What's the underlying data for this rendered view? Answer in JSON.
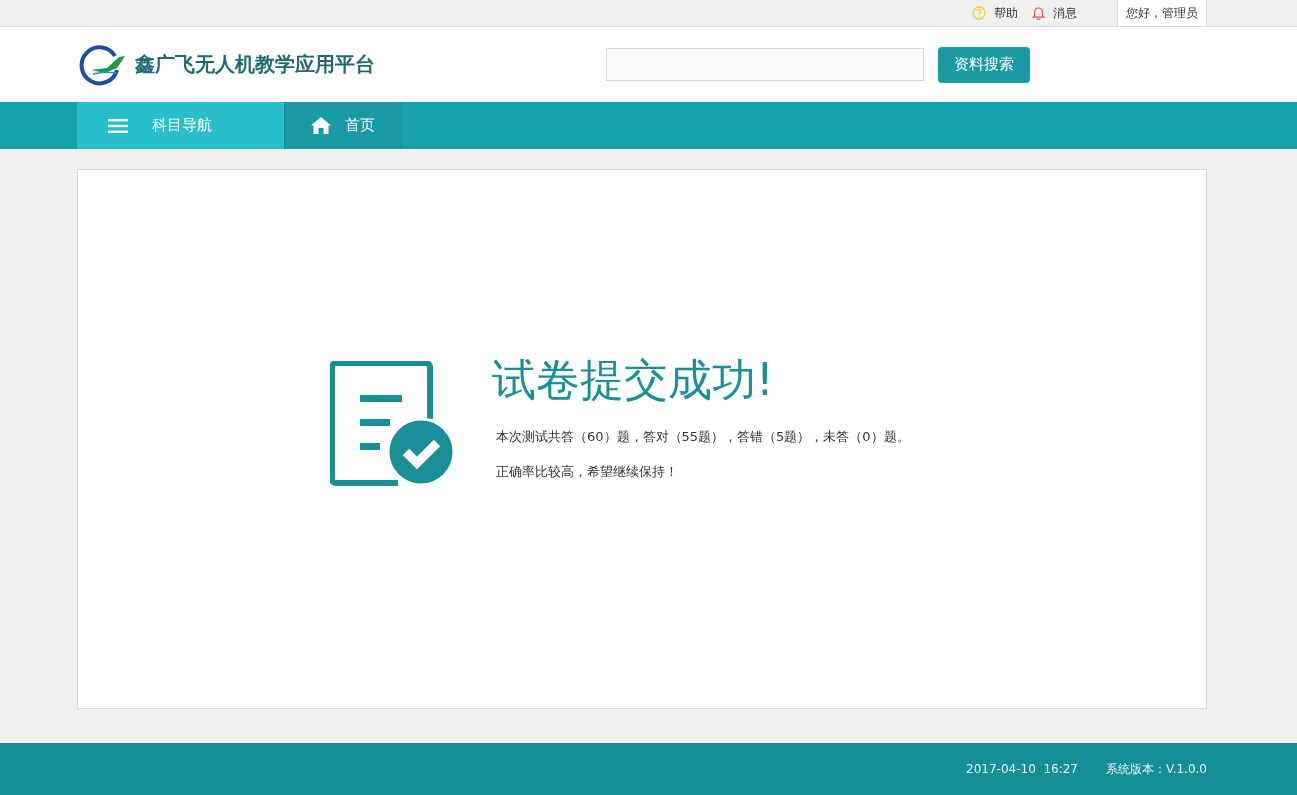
{
  "top_bar": {
    "help": "帮助",
    "messages": "消息",
    "greeting": "您好，管理员"
  },
  "header": {
    "logo_text": "鑫广飞无人机教学应用平台",
    "search_button": "资料搜索"
  },
  "nav": [
    {
      "label": "科目导航",
      "selected": true
    },
    {
      "label": "首页",
      "selected": false
    }
  ],
  "result": {
    "title": "试卷提交成功!",
    "summary": "本次测试共答（60）题，答对（55题），答错（5题），未答（0）题。",
    "comment": "正确率比较高，希望继续保持！"
  },
  "footer": {
    "datetime": "2017-04-10  16:27",
    "version": "系统版本：V.1.0.0"
  }
}
